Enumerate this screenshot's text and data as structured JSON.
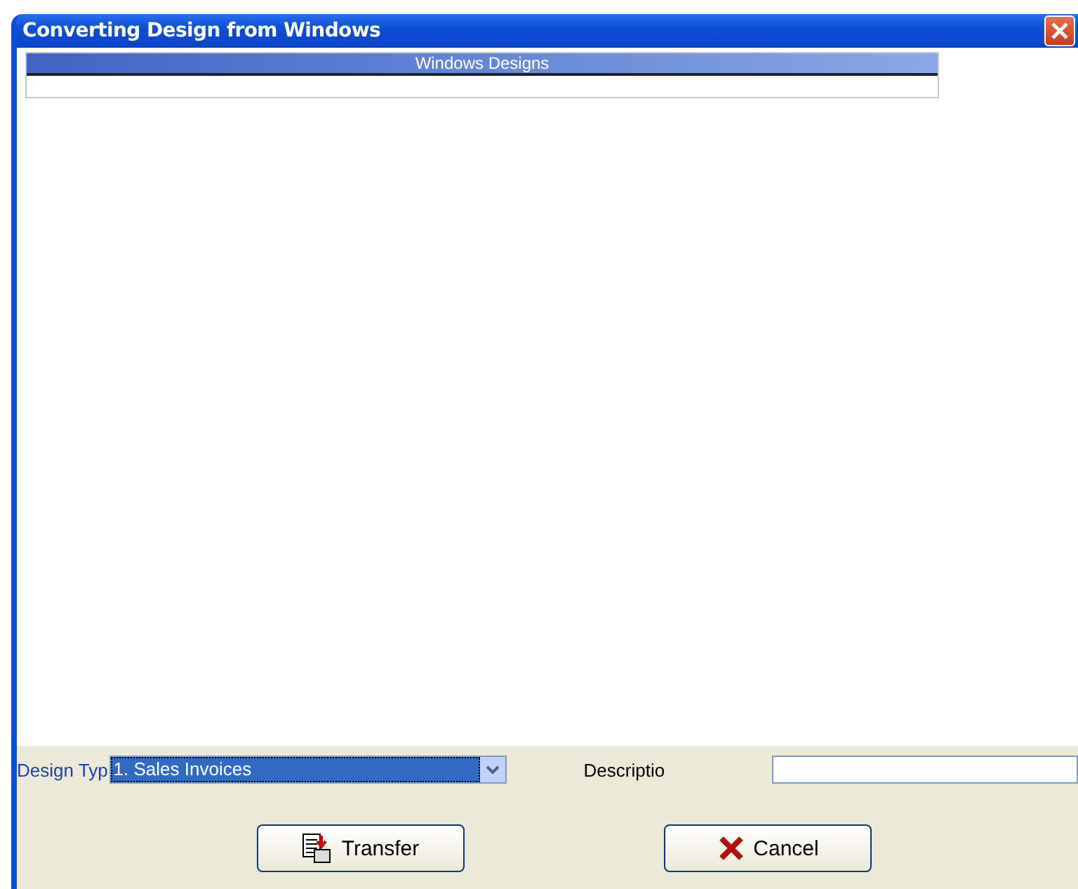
{
  "window": {
    "title": "Converting Design from Windows"
  },
  "grid": {
    "columns": [
      "Windows Designs"
    ]
  },
  "design_type": {
    "label": "Design Typ",
    "value": "1. Sales Invoices",
    "selected": true
  },
  "description": {
    "label": "Descriptio"
  },
  "buttons": [
    {
      "kind": "transfer",
      "label": "Transfer"
    },
    {
      "kind": "cancel",
      "label": "Cancel"
    }
  ]
}
